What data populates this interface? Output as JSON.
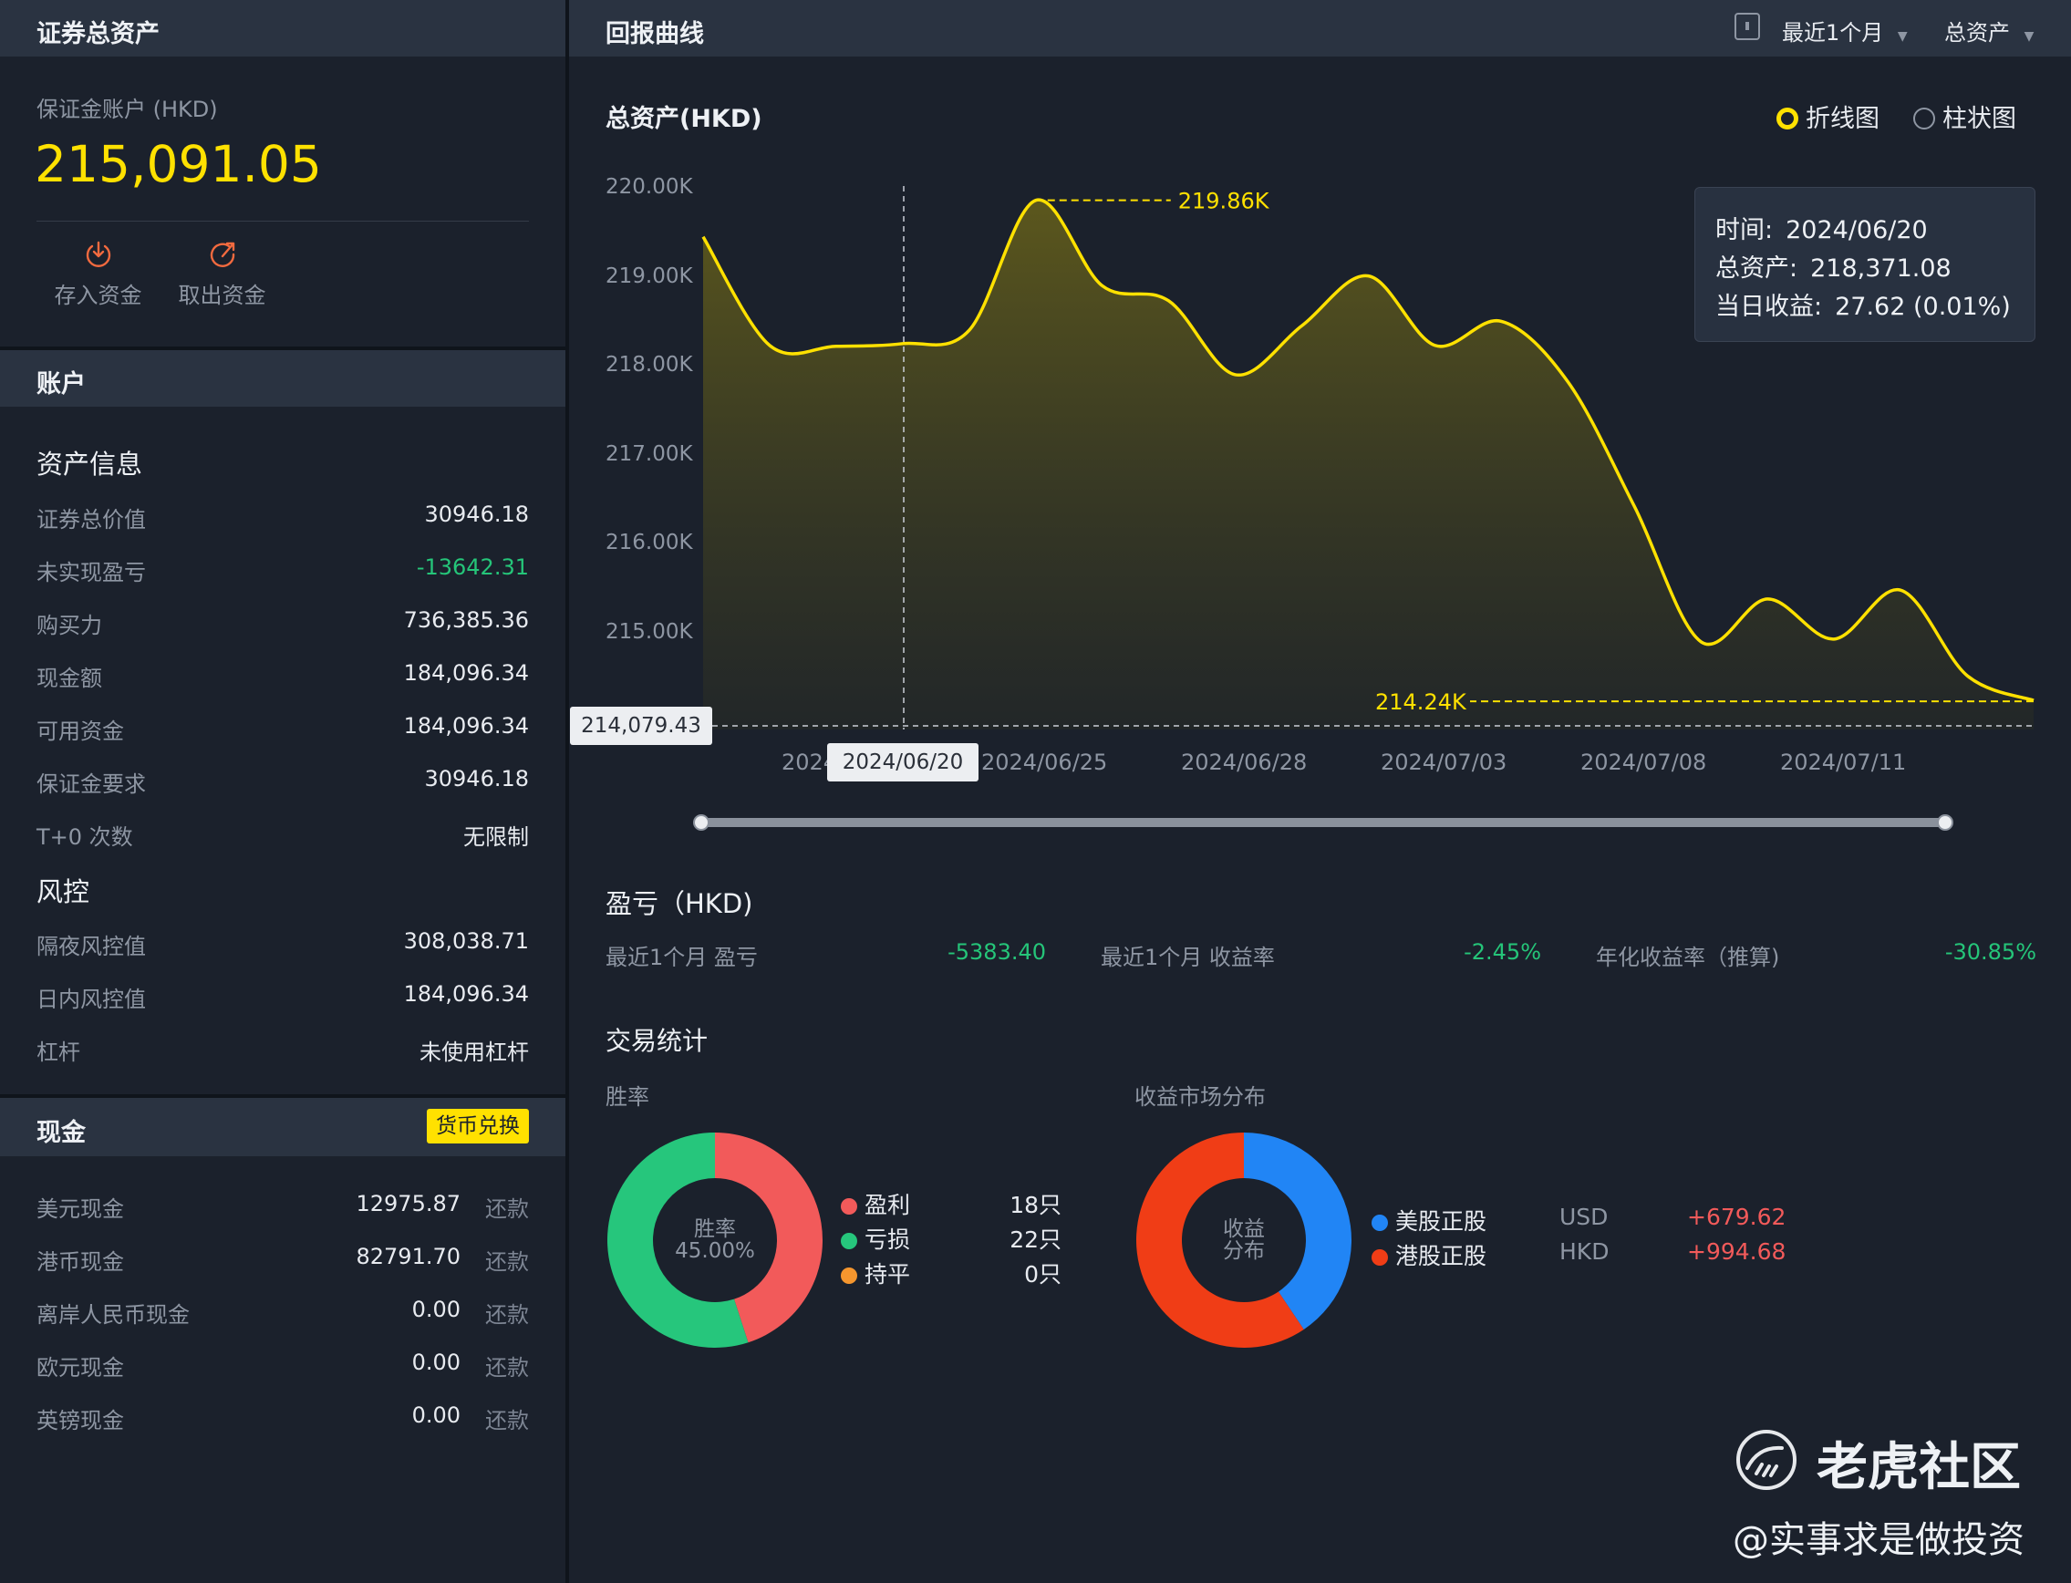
{
  "left": {
    "header_title": "证券总资产",
    "account_label": "保证金账户 (HKD)",
    "total_value": "215,091.05",
    "deposit_label": "存入资金",
    "withdraw_label": "取出资金",
    "account_section": "账户",
    "asset_info_title": "资产信息",
    "asset_rows": [
      {
        "label": "证券总价值",
        "value": "30946.18"
      },
      {
        "label": "未实现盈亏",
        "value": "-13642.31"
      },
      {
        "label": "购买力",
        "value": "736,385.36"
      },
      {
        "label": "现金额",
        "value": "184,096.34"
      },
      {
        "label": "可用资金",
        "value": "184,096.34"
      },
      {
        "label": "保证金要求",
        "value": "30946.18"
      },
      {
        "label": "T+0 次数",
        "value": "无限制"
      }
    ],
    "risk_title": "风控",
    "risk_rows": [
      {
        "label": "隔夜风控值",
        "value": "308,038.71"
      },
      {
        "label": "日内风控值",
        "value": "184,096.34"
      },
      {
        "label": "杠杆",
        "value": "未使用杠杆"
      }
    ],
    "cash_section": "现金",
    "fx_button": "货币兑换",
    "cash_rows": [
      {
        "label": "美元现金",
        "value": "12975.87",
        "action": "还款"
      },
      {
        "label": "港币现金",
        "value": "82791.70",
        "action": "还款"
      },
      {
        "label": "离岸人民币现金",
        "value": "0.00",
        "action": "还款"
      },
      {
        "label": "欧元现金",
        "value": "0.00",
        "action": "还款"
      },
      {
        "label": "英镑现金",
        "value": "0.00",
        "action": "还款"
      }
    ]
  },
  "right": {
    "header_title": "回报曲线",
    "period_select": "最近1个月",
    "metric_select": "总资产",
    "chart_title": "总资产(HKD)",
    "toggle_line": "折线图",
    "toggle_bar": "柱状图",
    "tooltip": {
      "time_label": "时间:",
      "time_value": "2024/06/20",
      "asset_label": "总资产:",
      "asset_value": "218,371.08",
      "gain_label": "当日收益:",
      "gain_value": "27.62 (0.01%)"
    },
    "crosshair_y_value": "214,079.43",
    "crosshair_x_value": "2024/06/20",
    "pnl_title": "盈亏（HKD)",
    "pnl_metrics": [
      {
        "label": "最近1个月 盈亏",
        "value": "-5383.40"
      },
      {
        "label": "最近1个月 收益率",
        "value": "-2.45%"
      },
      {
        "label": "年化收益率（推算)",
        "value": "-30.85%"
      }
    ],
    "trade_title": "交易统计",
    "win_rate_title": "胜率",
    "win_center_1": "胜率",
    "win_center_2": "45.00%",
    "win_legend": [
      {
        "label": "盈利",
        "count": "18只",
        "color": "#f25a5a"
      },
      {
        "label": "亏损",
        "count": "22只",
        "color": "#26c67c"
      },
      {
        "label": "持平",
        "count": "0只",
        "color": "#f5962e"
      }
    ],
    "market_title": "收益市场分布",
    "market_center_1": "收益",
    "market_center_2": "分布",
    "market_legend": [
      {
        "label": "美股正股",
        "currency": "USD",
        "value": "+679.62",
        "color": "#2185f5"
      },
      {
        "label": "港股正股",
        "currency": "HKD",
        "value": "+994.68",
        "color": "#f03d16"
      }
    ],
    "watermark_brand": "老虎社区",
    "watermark_author": "@实事求是做投资"
  },
  "chart_data": {
    "type": "area",
    "title": "总资产(HKD)",
    "yticks": [
      "220.00K",
      "219.00K",
      "218.00K",
      "217.00K",
      "216.00K",
      "215.00K"
    ],
    "ylim": [
      214000,
      220000
    ],
    "xticks": [
      "2024",
      "2024/06/25",
      "2024/06/28",
      "2024/07/03",
      "2024/07/08",
      "2024/07/11"
    ],
    "max_label": "219.86K",
    "min_label": "214.24K",
    "series": [
      {
        "values": [
          219450,
          218230,
          218220,
          218250,
          218400,
          219860,
          218900,
          218730,
          217900,
          218450,
          219010,
          218230,
          218500,
          217820,
          216420,
          214900,
          215380,
          214930,
          215480,
          214520,
          214240
        ]
      }
    ],
    "pie_win": [
      {
        "label": "盈利",
        "value": 18
      },
      {
        "label": "亏损",
        "value": 22
      },
      {
        "label": "持平",
        "value": 0
      }
    ],
    "pie_market": [
      {
        "label": "美股正股",
        "value": 679.62
      },
      {
        "label": "港股正股",
        "value": 994.68
      }
    ],
    "colors": {
      "line": "#ffe100",
      "profit": "#f25a5a",
      "loss": "#26c67c",
      "flat": "#f5962e",
      "us": "#2185f5",
      "hk": "#f03d16"
    }
  }
}
